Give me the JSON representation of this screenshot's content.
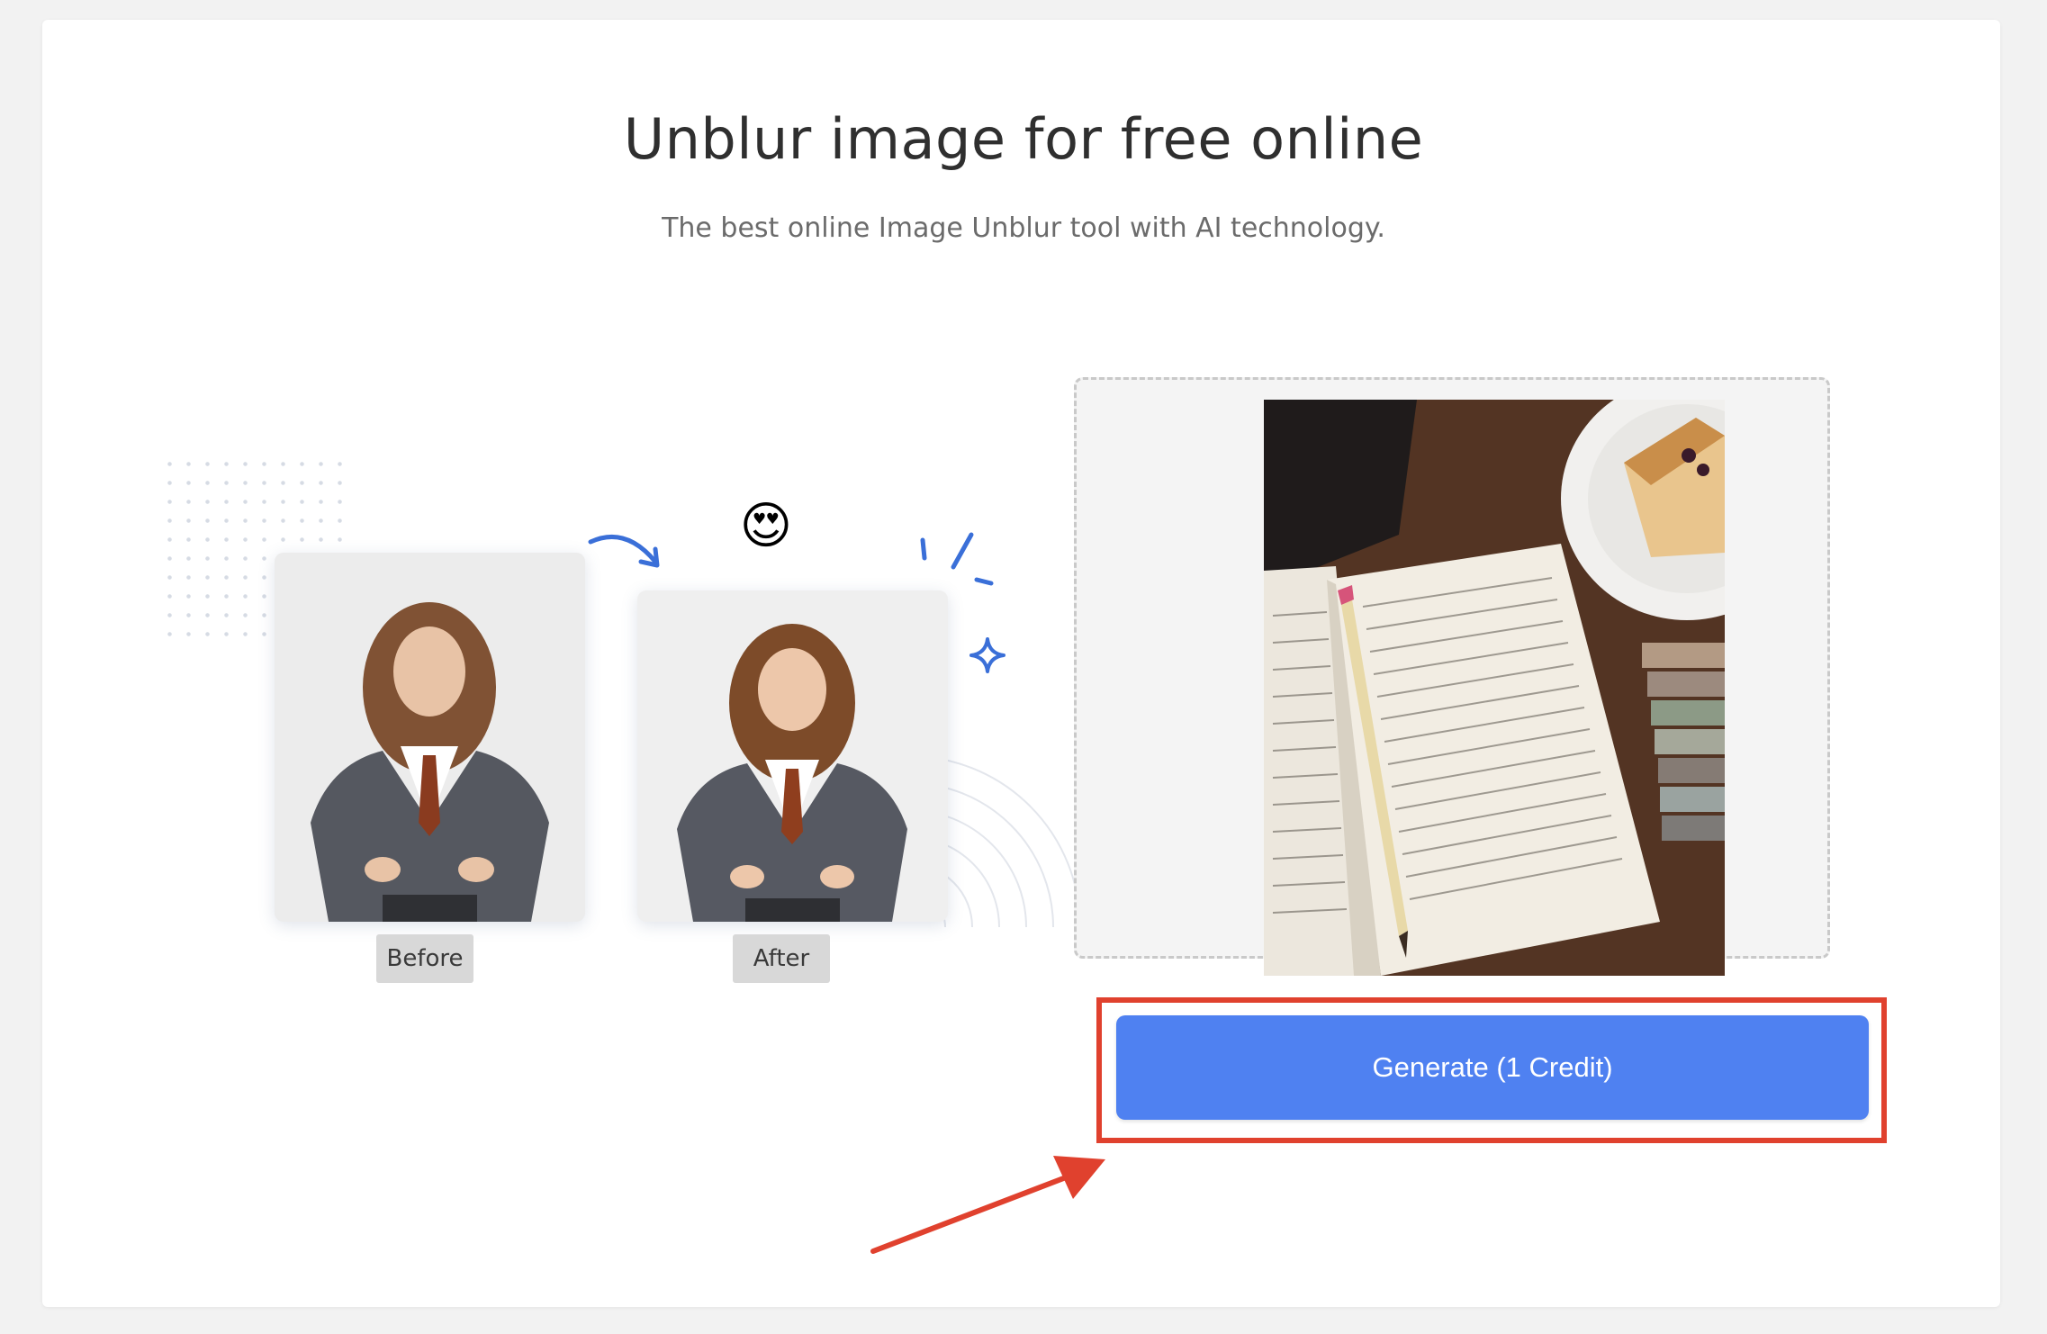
{
  "page": {
    "title": "Unblur image for free online",
    "subtitle": "The best online Image Unblur tool with AI technology."
  },
  "demo": {
    "before_label": "Before",
    "after_label": "After",
    "emoji": "😍"
  },
  "upload": {
    "image_description": "uploaded-photo"
  },
  "actions": {
    "generate_label": "Generate (1 Credit)"
  },
  "colors": {
    "accent": "#4f81f1",
    "highlight": "#e0412e",
    "demo_accent": "#3a6fd8"
  },
  "icons": {
    "transform_arrow": "curved-arrow-icon",
    "sparkle": "sparkle-icon",
    "annotation_arrow": "red-arrow-icon"
  }
}
